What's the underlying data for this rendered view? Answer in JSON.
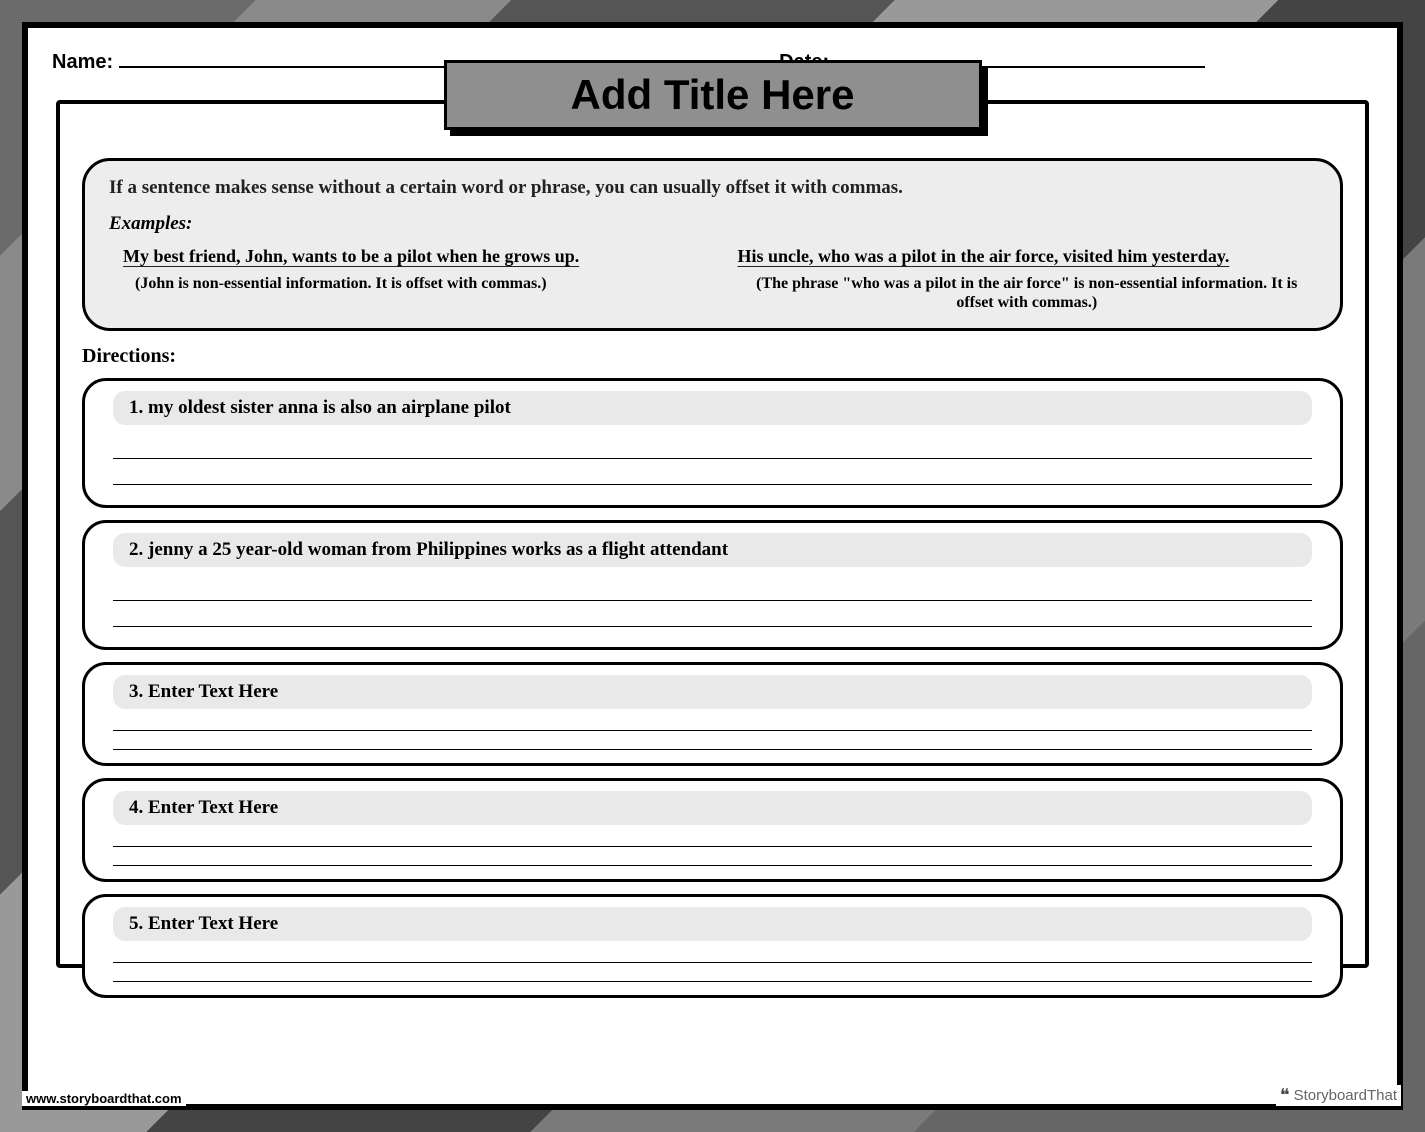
{
  "header": {
    "name_label": "Name:",
    "date_label": "Date:"
  },
  "title": "Add Title Here",
  "info": {
    "rule": "If a sentence makes sense without a certain word or phrase, you can usually offset it with commas.",
    "examples_label": "Examples:",
    "example1_sentence": "My best friend, John, wants to be a pilot when he grows up.",
    "example1_note": "(John is non-essential information. It is offset with commas.)",
    "example2_sentence": "His uncle, who was a pilot in the air force, visited him yesterday.",
    "example2_note": "(The phrase \"who was a pilot in the air force\" is non-essential information. It is offset with commas.)"
  },
  "directions_label": "Directions:",
  "questions": [
    {
      "prompt": "1. my oldest sister anna is also an airplane pilot"
    },
    {
      "prompt": "2. jenny a 25 year-old woman from Philippines works as a flight attendant"
    },
    {
      "prompt": "3. Enter Text Here"
    },
    {
      "prompt": "4. Enter Text Here"
    },
    {
      "prompt": "5. Enter Text Here"
    }
  ],
  "footer": {
    "url": "www.storyboardthat.com",
    "brand": "StoryboardThat"
  }
}
